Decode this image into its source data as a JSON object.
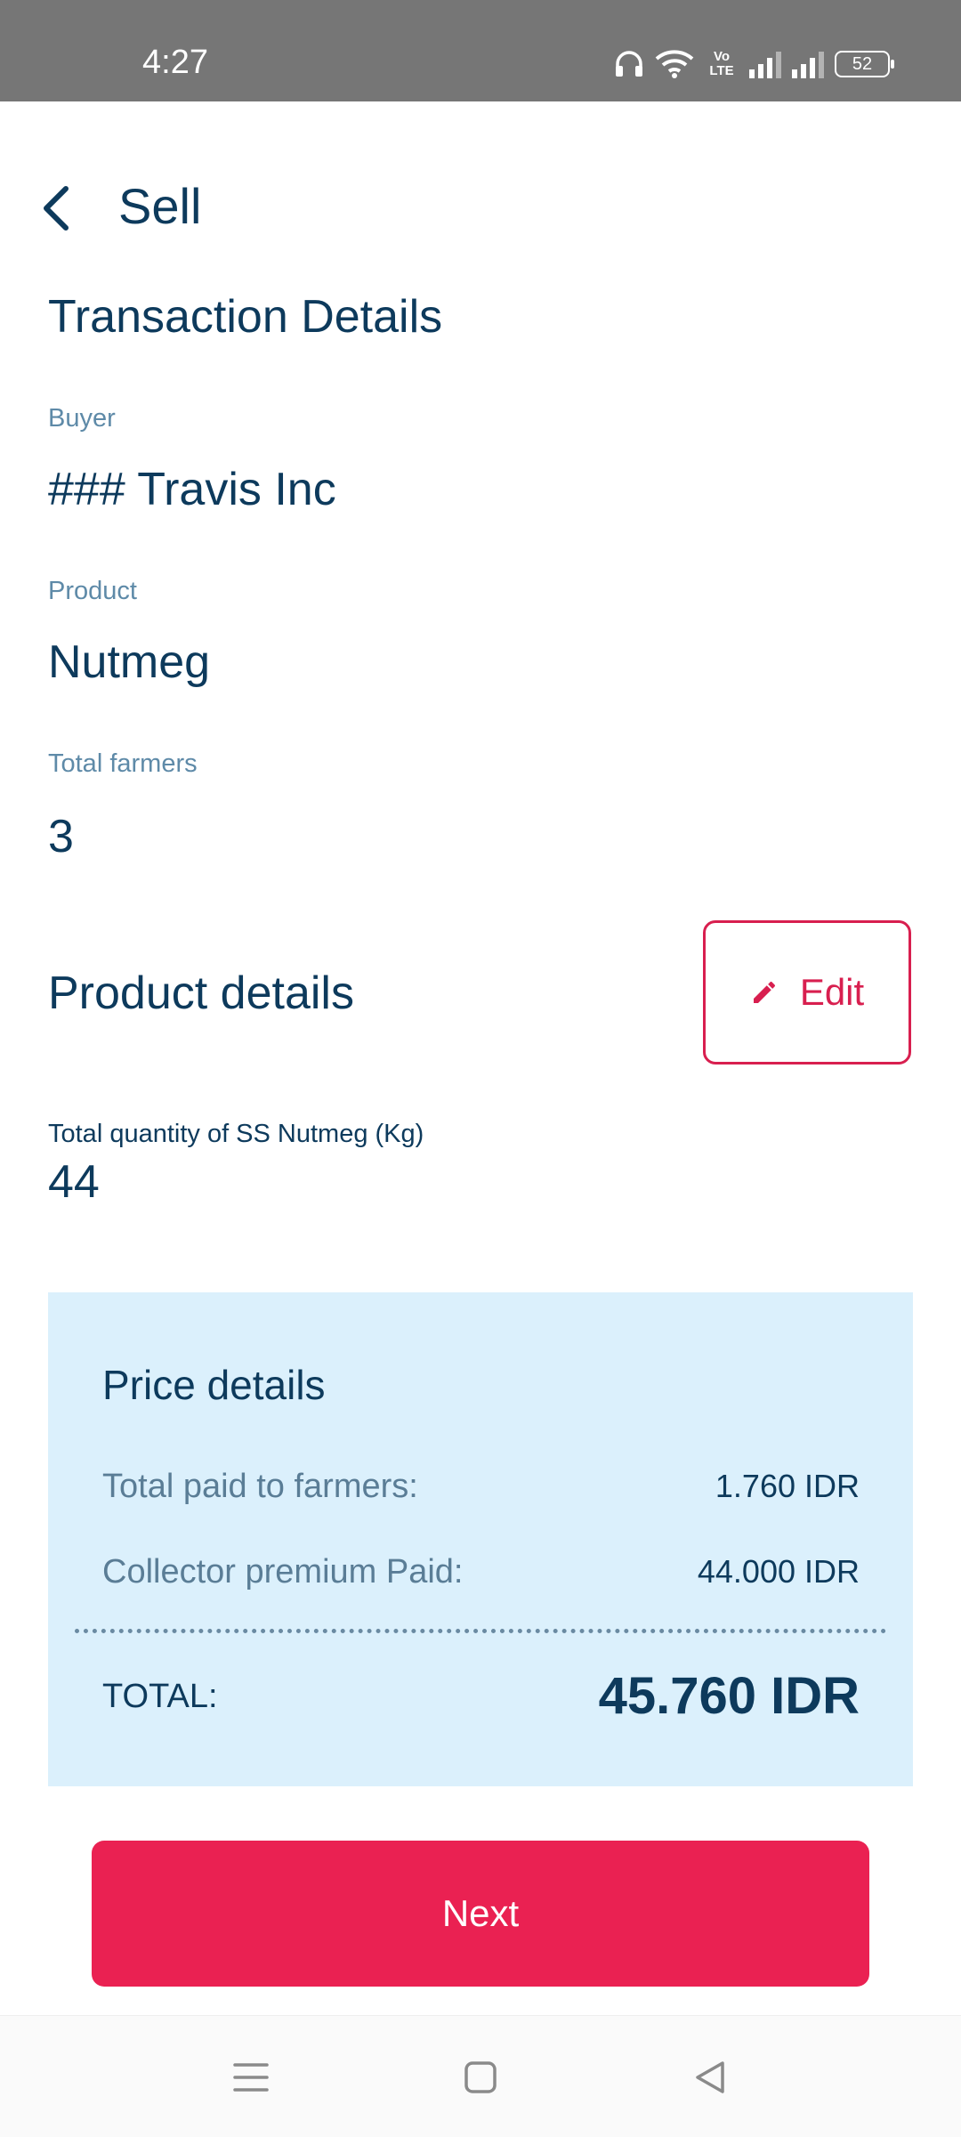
{
  "status_bar": {
    "time": "4:27",
    "volte_label": "Vo LTE",
    "battery": "52",
    "icons": [
      "headphones-icon",
      "wifi-icon",
      "signal-icon",
      "signal-icon",
      "battery-icon"
    ]
  },
  "header": {
    "back_icon": "chevron-left-icon",
    "title": "Sell"
  },
  "transaction": {
    "heading": "Transaction Details",
    "buyer_label": "Buyer",
    "buyer_value": "### Travis Inc",
    "product_label": "Product",
    "product_value": "Nutmeg",
    "farmers_label": "Total farmers",
    "farmers_value": "3"
  },
  "product_details": {
    "heading": "Product details",
    "edit_label": "Edit",
    "edit_icon": "pencil-icon",
    "quantity_label": "Total quantity of SS Nutmeg (Kg)",
    "quantity_value": "44"
  },
  "price_details": {
    "heading": "Price details",
    "rows": [
      {
        "label": "Total paid to farmers:",
        "value": "1.760 IDR"
      },
      {
        "label": "Collector premium Paid:",
        "value": "44.000 IDR"
      }
    ],
    "total_label": "TOTAL:",
    "total_value": "45.760 IDR",
    "background_color": "#dbf0fc"
  },
  "actions": {
    "next_label": "Next",
    "primary_color": "#ea2152"
  },
  "nav_bar": {
    "icons": [
      "menu-icon",
      "home-square-icon",
      "back-triangle-icon"
    ]
  }
}
